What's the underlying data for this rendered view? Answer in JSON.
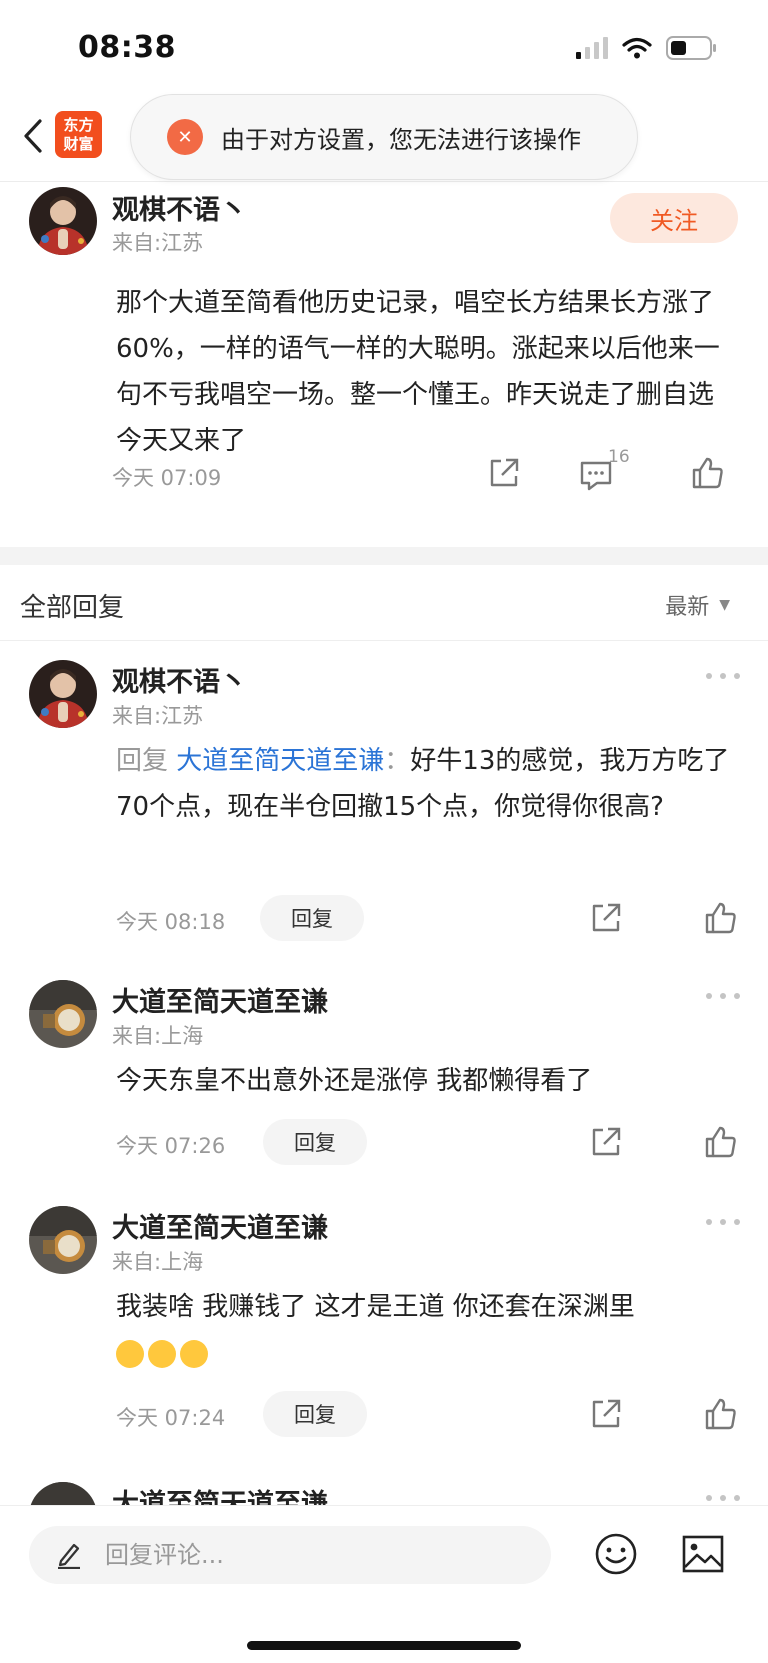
{
  "status_bar": {
    "time": "08:38"
  },
  "nav": {
    "logo_line1": "东方",
    "logo_line2": "财富",
    "toast_text": "由于对方设置，您无法进行该操作"
  },
  "main_post": {
    "username": "观棋不语丶",
    "location": "来自:江苏",
    "follow_label": "关注",
    "content": "那个大道至简看他历史记录，唱空长方结果长方涨了60%，一样的语气一样的大聪明。涨起来以后他来一句不亏我唱空一场。整一个懂王。昨天说走了删自选今天又来了",
    "time": "今天 07:09",
    "comment_count": "16"
  },
  "replies_section": {
    "title": "全部回复",
    "sort_label": "最新"
  },
  "replies": [
    {
      "username": "观棋不语丶",
      "location": "来自:江苏",
      "prefix": "回复 ",
      "mention": "大道至简天道至谦",
      "colon": "：",
      "text": "好牛13的感觉，我万方吃了70个点，现在半仓回撤15个点，你觉得你很高?",
      "time": "今天 08:18",
      "reply_label": "回复"
    },
    {
      "username": "大道至简天道至谦",
      "location": "来自:上海",
      "text": "今天东皇不出意外还是涨停 我都懒得看了",
      "time": "今天 07:26",
      "reply_label": "回复"
    },
    {
      "username": "大道至简天道至谦",
      "location": "来自:上海",
      "text": "我装啥 我赚钱了 这才是王道  你还套在深渊里",
      "emoji_count": 3,
      "time": "今天 07:24",
      "reply_label": "回复"
    },
    {
      "username": "大道至简天道至谦"
    }
  ],
  "bottom_bar": {
    "input_placeholder": "回复评论..."
  },
  "icons": {
    "back": "chevron-left-icon",
    "share": "share-icon",
    "comment": "comment-icon",
    "like": "thumbs-up-icon",
    "more": "more-dots-icon",
    "emoji": "emoji-icon",
    "image": "image-icon",
    "pen": "pen-icon"
  },
  "colors": {
    "brand": "#f24e1e",
    "follow_text": "#f05a24",
    "follow_bg": "#fde8de",
    "mention": "#2b74d6",
    "toast_icon": "#f26a45"
  }
}
